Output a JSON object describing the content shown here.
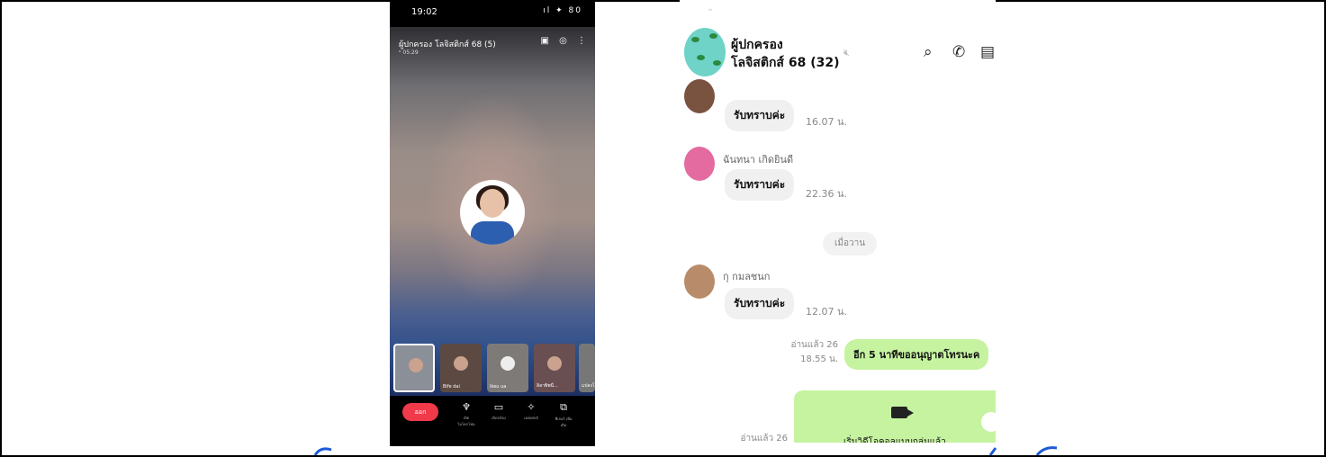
{
  "phone": {
    "status_time": "19:02",
    "status_icons": "ıl ✦ 80",
    "call_title": "ผู้ปกครอง โลจิสติกส์ 68 (5)",
    "call_subtitle": "ᵒ 05:29",
    "participants": [
      {
        "label": ""
      },
      {
        "label": "Bife  dai"
      },
      {
        "label": "Ikeu  ua"
      },
      {
        "label": "ลิลาพิพนี่..."
      },
      {
        "label": "แปลงโฉ"
      }
    ],
    "leave_label": "ออก",
    "controls": [
      {
        "icon": "mic-icon",
        "label": "เปิด ไมโครโฟน"
      },
      {
        "icon": "camera-icon",
        "label": "เปิดกล้อง"
      },
      {
        "icon": "effects-icon",
        "label": "เอฟเฟกต์"
      },
      {
        "icon": "share-icon",
        "label": "ฟีเจอร์ เพิ่มเติม"
      }
    ]
  },
  "chat": {
    "group_name_line1": "ผู้ปกครอง",
    "group_name_line2": "โลจิสติกส์ 68 (32)",
    "header_icons": [
      "search-icon",
      "phone-icon",
      "notes-icon"
    ],
    "messages": [
      {
        "sender": "",
        "text": "รับทราบค่ะ",
        "time": "16.07 น."
      },
      {
        "sender": "ฉันทนา เกิดยินดี",
        "text": "รับทราบค่ะ",
        "time": "22.36 น."
      },
      {
        "sender": "กุ กมลชนก",
        "text": "รับทราบค่ะ",
        "time": "12.07 น."
      }
    ],
    "date_separator": "เมื่อวาน",
    "my_message": {
      "read": "อ่านแล้ว 26",
      "time": "18.55 น.",
      "text": "อีก 5 นาทีขออนุญาตโทรนะค"
    },
    "video_message": {
      "read": "อ่านแล้ว 26",
      "text": "เริ่มวิดีโอคอลแบบกลุ่มแล้ว"
    }
  },
  "colors": {
    "leave": "#f03a4a",
    "my_bubble": "#c6f3a0",
    "other_bubble": "#f0f0f0"
  }
}
